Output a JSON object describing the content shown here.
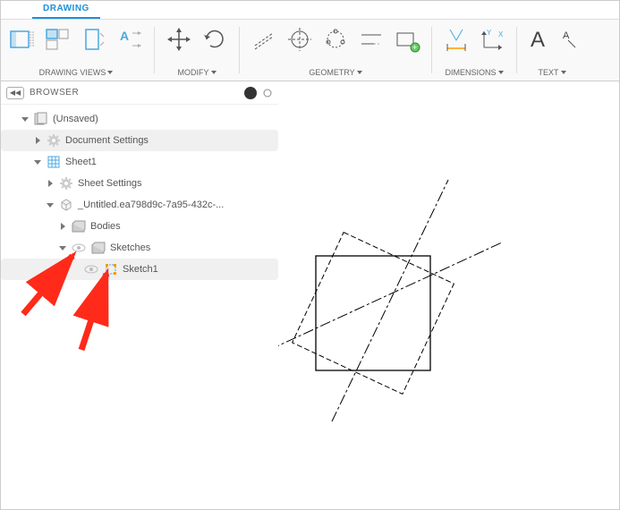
{
  "active_tab": "DRAWING",
  "ribbon": {
    "groups": [
      {
        "label": "DRAWING VIEWS"
      },
      {
        "label": "MODIFY"
      },
      {
        "label": "GEOMETRY"
      },
      {
        "label": "DIMENSIONS"
      },
      {
        "label": "TEXT"
      }
    ]
  },
  "browser": {
    "title": "BROWSER",
    "tree": {
      "root": "(Unsaved)",
      "items": [
        {
          "label": "Document Settings"
        },
        {
          "label": "Sheet1"
        },
        {
          "label": "Sheet Settings"
        },
        {
          "label": "_Untitled.ea798d9c-7a95-432c-..."
        },
        {
          "label": "Bodies"
        },
        {
          "label": "Sketches"
        },
        {
          "label": "Sketch1"
        }
      ]
    }
  }
}
